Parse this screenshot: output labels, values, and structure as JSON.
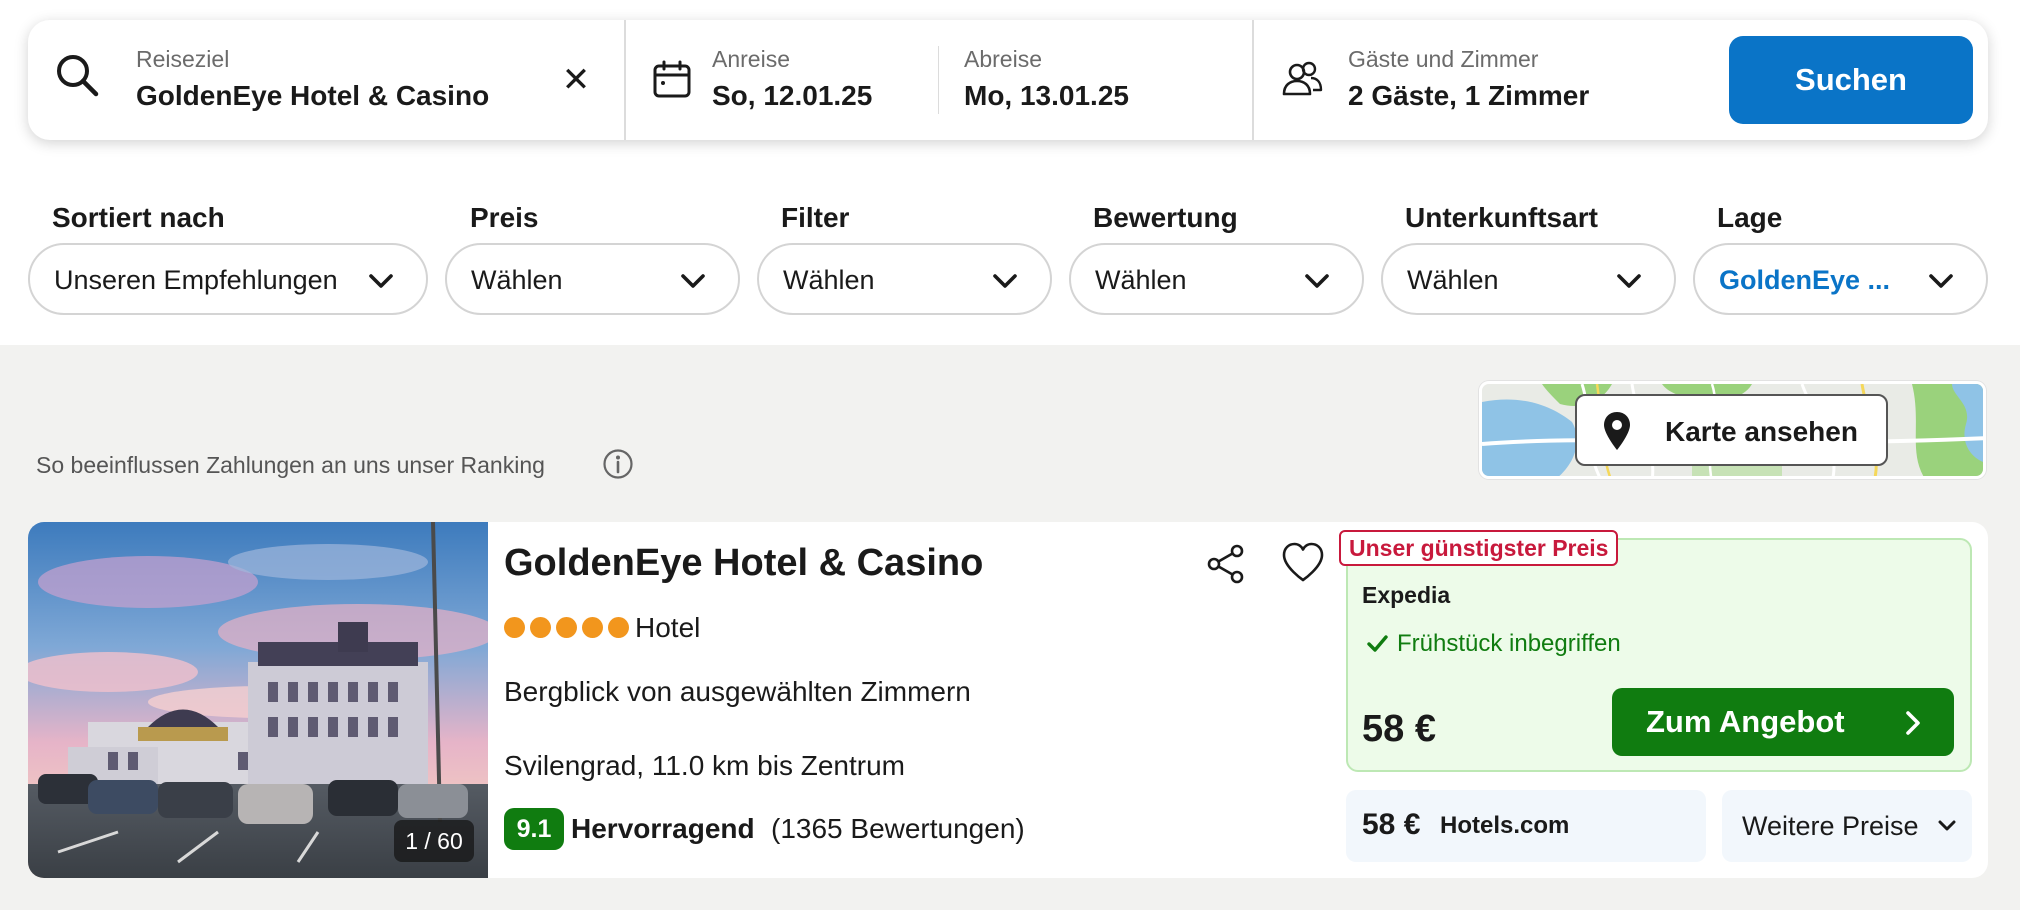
{
  "search": {
    "destination": {
      "label": "Reiseziel",
      "value": "GoldenEye Hotel & Casino",
      "clear": "✕"
    },
    "checkin": {
      "label": "Anreise",
      "value": "So, 12.01.25"
    },
    "checkout": {
      "label": "Abreise",
      "value": "Mo, 13.01.25"
    },
    "guests": {
      "label": "Gäste und Zimmer",
      "value": "2 Gäste, 1 Zimmer"
    },
    "submit_label": "Suchen",
    "accent_color": "#0a74c7"
  },
  "filters": [
    {
      "label": "Sortiert nach",
      "value": "Unseren Empfehlungen"
    },
    {
      "label": "Preis",
      "value": "Wählen"
    },
    {
      "label": "Filter",
      "value": "Wählen"
    },
    {
      "label": "Bewertung",
      "value": "Wählen"
    },
    {
      "label": "Unterkunftsart",
      "value": "Wählen"
    },
    {
      "label": "Lage",
      "value": "GoldenEye ..."
    }
  ],
  "ranking_note": "So beeinflussen Zahlungen an uns unser Ranking",
  "map": {
    "button_label": "Karte ansehen"
  },
  "result": {
    "name": "GoldenEye Hotel & Casino",
    "star_rating": 5,
    "type": "Hotel",
    "feature": "Bergblick von ausgewählten Zimmern",
    "location": "Svilengrad, 11.0 km bis Zentrum",
    "photo_counter": "1 / 60",
    "rating": {
      "score": "9.1",
      "label": "Hervorragend",
      "count": "(1365 Bewertungen)",
      "color": "#107c10"
    },
    "best_offer": {
      "badge": "Unser günstigster Preis",
      "provider": "Expedia",
      "perk": "Frühstück inbegriffen",
      "price": "58 €",
      "cta_label": "Zum Angebot"
    },
    "alt_offer": {
      "price": "58 €",
      "provider": "Hotels.com"
    },
    "more_prices_label": "Weitere Preise"
  }
}
